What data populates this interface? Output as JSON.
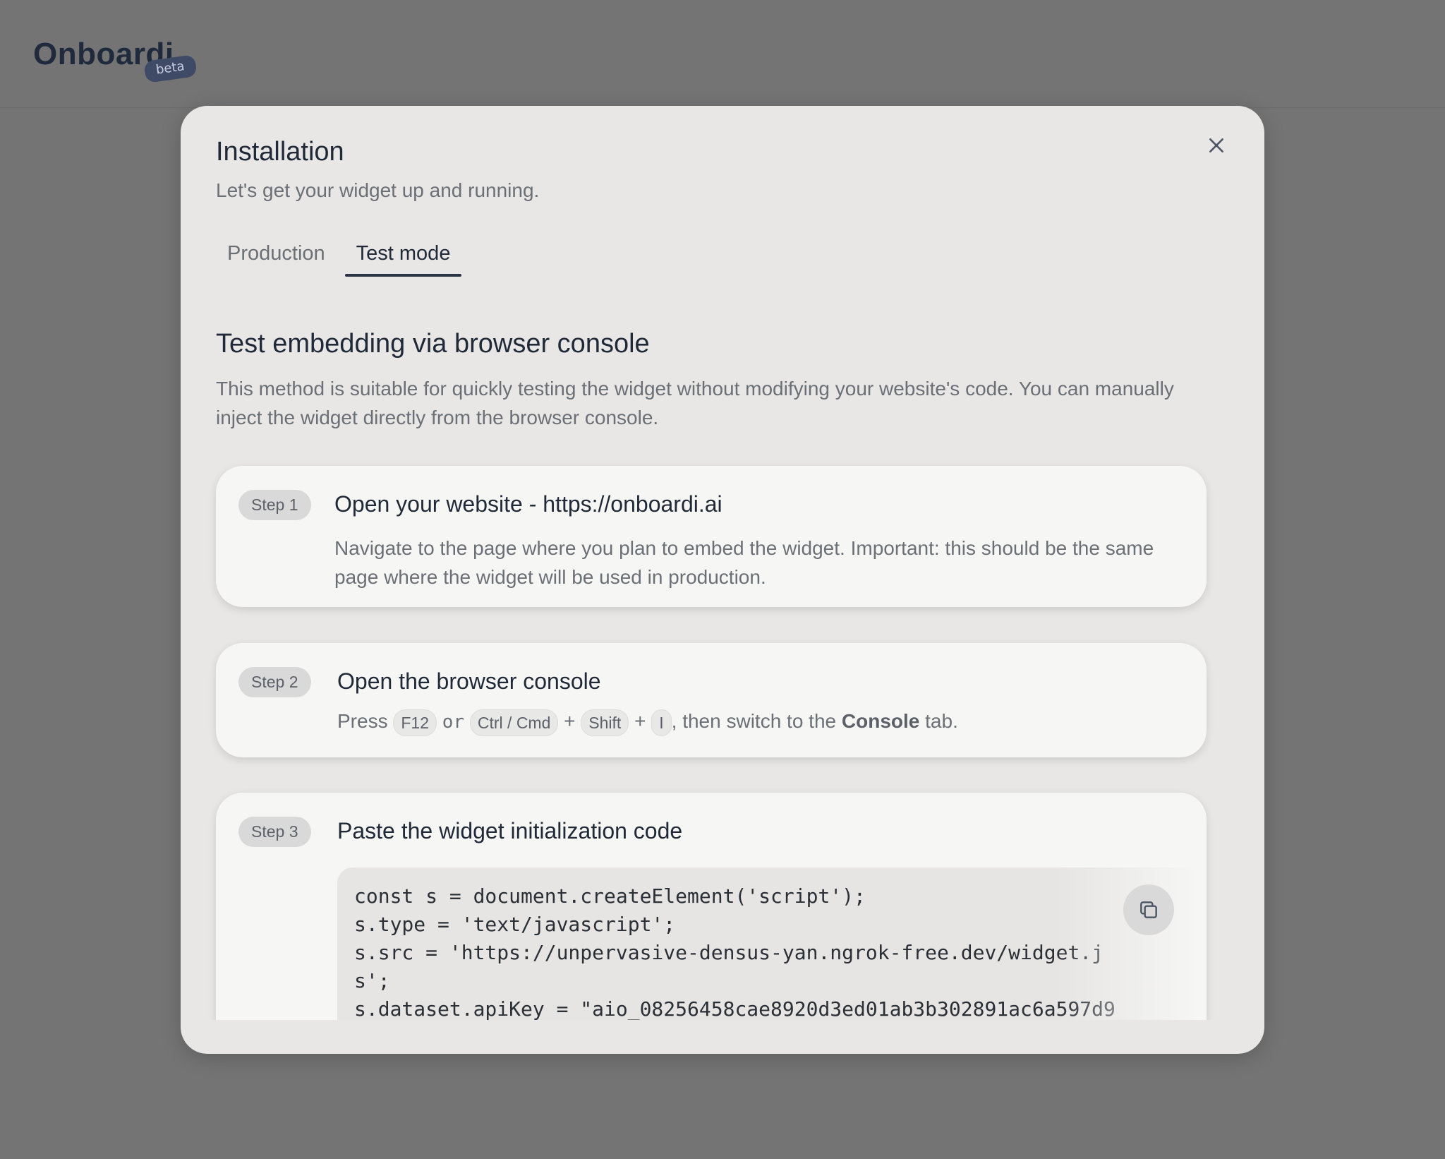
{
  "app": {
    "logo": "Onboardi",
    "beta_badge": "beta"
  },
  "modal": {
    "title": "Installation",
    "subtitle": "Let's get your widget up and running.",
    "tabs": [
      {
        "label": "Production",
        "active": false
      },
      {
        "label": "Test mode",
        "active": true
      }
    ],
    "section_title": "Test embedding via browser console",
    "section_desc": "This method is suitable for quickly testing the widget without modifying your website's code. You can manually inject the widget directly from the browser console.",
    "steps": [
      {
        "badge": "Step 1",
        "title": "Open your website - https://onboardi.ai",
        "body": "Navigate to the page where you plan to embed the widget. Important: this should be the same page where the widget will be used in production."
      },
      {
        "badge": "Step 2",
        "title": "Open the browser console",
        "body_press": "Press",
        "key_f12": "F12",
        "or": "or",
        "key_ctrl": "Ctrl / Cmd",
        "plus1": "+",
        "key_shift": "Shift",
        "plus2": "+",
        "key_i": "I",
        "body_then": ", then switch to the",
        "body_console": "Console",
        "body_tab": "tab."
      },
      {
        "badge": "Step 3",
        "title": "Paste the widget initialization code",
        "code_lines": [
          "const s = document.createElement('script');",
          "s.type = 'text/javascript';",
          "s.src = 'https://unpervasive-densus-yan.ngrok-free.dev/widget.j",
          "s';",
          "s.dataset.apiKey = \"aio_08256458cae8920d3ed01ab3b302891ac6a597d9"
        ]
      }
    ]
  },
  "icons": {
    "close": "close-icon",
    "copy": "copy-icon"
  },
  "colors": {
    "backdrop": "#747474",
    "modal_bg": "#e8e7e6",
    "card_bg": "#f6f6f5",
    "accent": "#2b3445"
  }
}
